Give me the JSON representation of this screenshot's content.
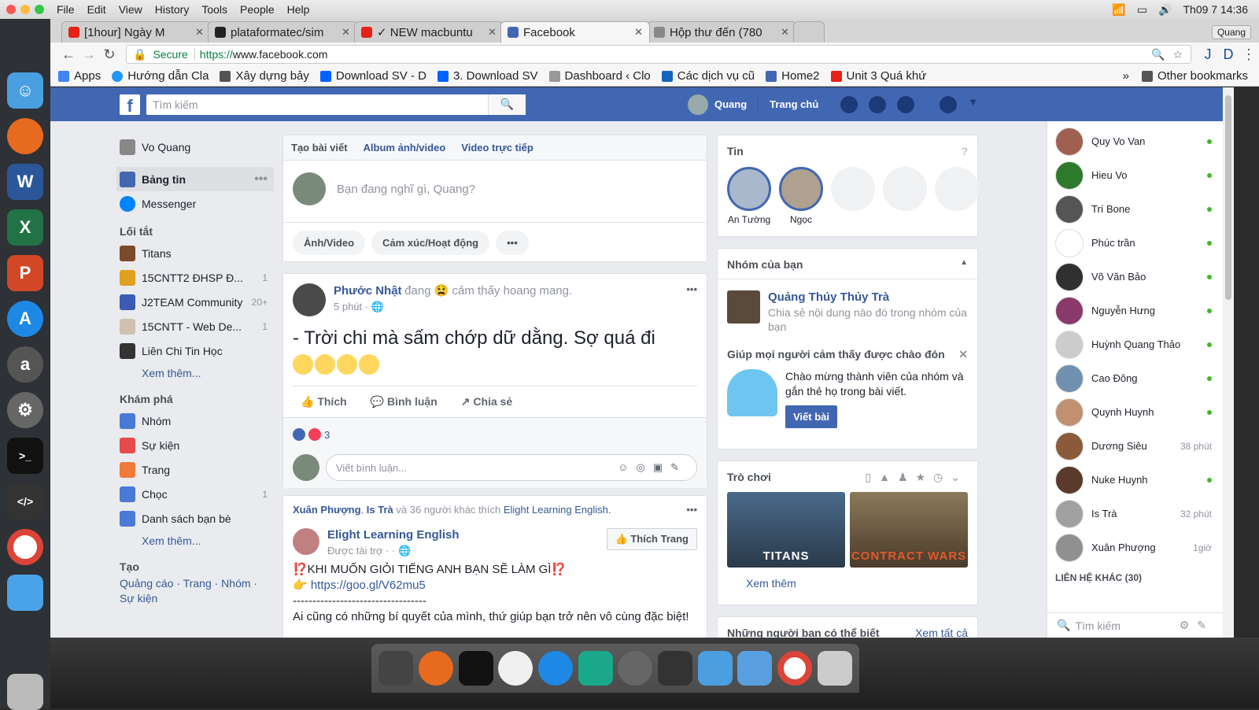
{
  "menubar": {
    "items": [
      "File",
      "Edit",
      "View",
      "History",
      "Tools",
      "People",
      "Help"
    ],
    "clock": "Th09 7 14:36",
    "user": "Quang"
  },
  "tabs": [
    {
      "title": "[1hour] Ngày M",
      "color": "#e62117"
    },
    {
      "title": "plataformatec/sim",
      "color": "#222222"
    },
    {
      "title": "✓ NEW macbuntu",
      "color": "#e62117"
    },
    {
      "title": "Facebook",
      "color": "#4267b2"
    },
    {
      "title": "Hộp thư đến (780",
      "color": "#888888"
    }
  ],
  "address": {
    "secure": "Secure",
    "https": "https://",
    "url": "www.facebook.com"
  },
  "bookmarks": [
    {
      "label": "Apps",
      "color": "#4285f4"
    },
    {
      "label": "Hướng dẫn Cla",
      "color": "#2196f3"
    },
    {
      "label": "Xây dựng bảy",
      "color": "#555555"
    },
    {
      "label": "Download SV - D",
      "color": "#0061ff"
    },
    {
      "label": "3. Download SV",
      "color": "#0061ff"
    },
    {
      "label": "Dashboard ‹ Clo",
      "color": "#999999"
    },
    {
      "label": "Các dịch vụ cũ",
      "color": "#1565c0"
    },
    {
      "label": "Home2",
      "color": "#4267b2"
    },
    {
      "label": "Unit 3 Quá khứ",
      "color": "#e62117"
    }
  ],
  "other_bookmarks": "Other bookmarks",
  "fb": {
    "search_placeholder": "Tìm kiếm",
    "user": "Quang",
    "home": "Trang chủ"
  },
  "left": {
    "profile": "Vo Quang",
    "main": [
      {
        "label": "Bảng tin",
        "color": "#4267b2"
      },
      {
        "label": "Messenger",
        "color": "#0084ff"
      }
    ],
    "shortcuts_title": "Lối tắt",
    "shortcuts": [
      {
        "label": "Titans",
        "count": "",
        "color": "#7a4a2a"
      },
      {
        "label": "15CNTT2 ĐHSP Đ...",
        "count": "1",
        "color": "#e0a020"
      },
      {
        "label": "J2TEAM Community",
        "count": "20+",
        "color": "#3b5bb5"
      },
      {
        "label": "15CNTT - Web De...",
        "count": "1",
        "color": "#d0c0b0"
      },
      {
        "label": "Liên Chi Tin Học",
        "count": "",
        "color": "#333333"
      }
    ],
    "see_more": "Xem thêm...",
    "explore_title": "Khám phá",
    "explore": [
      {
        "label": "Nhóm",
        "count": "",
        "color": "#4a79d6"
      },
      {
        "label": "Sự kiện",
        "count": "",
        "color": "#e64b4b"
      },
      {
        "label": "Trang",
        "count": "",
        "color": "#f07a3a"
      },
      {
        "label": "Chọc",
        "count": "1",
        "color": "#4a79d6"
      },
      {
        "label": "Danh sách bạn bè",
        "count": "",
        "color": "#4a79d6"
      }
    ],
    "create_title": "Tạo",
    "create_links": "Quảng cáo · Trang · Nhóm · Sự kiện"
  },
  "composer": {
    "tabs": [
      "Tạo bài viết",
      "Album ảnh/video",
      "Video trực tiếp"
    ],
    "placeholder": "Bạn đang nghĩ gì, Quang?",
    "actions": [
      "Ảnh/Video",
      "Cảm xúc/Hoạt động"
    ]
  },
  "post1": {
    "author": "Phước Nhật",
    "feeling": "đang 😫 cảm thấy hoang mang.",
    "time": "5 phút · 🌐",
    "text": "- Trời chi mà sấm chớp dữ dằng. Sợ quá đi",
    "like": "Thích",
    "comment": "Bình luận",
    "share": "Chia sẻ",
    "reactions": "3",
    "comment_placeholder": "Viết bình luận..."
  },
  "post2": {
    "liked_by_1": "Xuân Phượng",
    "liked_by_2": "Is Trà",
    "liked_rest": "và 36 người khác thích",
    "liked_page": "Elight Learning English.",
    "page": "Elight Learning English",
    "sponsored": "Được tài trợ · · 🌐",
    "like_page": "Thích Trang",
    "line1": "⁉️KHI MUỐN GIỎI TIẾNG ANH BẠN SẼ LÀM GÌ⁉️",
    "link": "👉 https://goo.gl/V62mu5",
    "divider": "----------------------------------",
    "line3": "Ai cũng có những bí quyết của mình, thứ giúp bạn trở nên vô cùng đặc biệt!"
  },
  "stories": {
    "title": "Tin",
    "items": [
      "An Tường",
      "Ngọc"
    ]
  },
  "groups": {
    "title": "Nhóm của bạn",
    "group": "Quảng Thúy Thủy Trà",
    "group_sub": "Chia sẻ nội dung nào đó trong nhóm của bạn",
    "welcome_title": "Giúp mọi người cảm thấy được chào đón",
    "welcome_text": "Chào mừng thành viên của nhóm và gắn thẻ họ trong bài viết.",
    "welcome_btn": "Viết bài"
  },
  "games": {
    "title": "Trò chơi",
    "items": [
      {
        "label": "TITANS",
        "color": "#3a4f6a"
      },
      {
        "label": "CONTRACT WARS",
        "color": "#6a5a3a"
      }
    ],
    "see_more": "Xem thêm"
  },
  "suggest": {
    "title": "Những người bạn có thể biết",
    "see_all": "Xem tất cả"
  },
  "chat": {
    "contacts": [
      {
        "name": "Quy Vo Van",
        "time": "",
        "color": "#a06050"
      },
      {
        "name": "Hieu Vo",
        "time": "",
        "color": "#2d7a2d"
      },
      {
        "name": "Trí Bone",
        "time": "",
        "color": "#555555"
      },
      {
        "name": "Phúc trần",
        "time": "",
        "color": "#ffffff"
      },
      {
        "name": "Võ Văn Bảo",
        "time": "",
        "color": "#303030"
      },
      {
        "name": "Nguyễn Hưng",
        "time": "",
        "color": "#8a3a6a"
      },
      {
        "name": "Huỳnh Quang Thảo",
        "time": "",
        "color": "#cccccc"
      },
      {
        "name": "Cao Đông",
        "time": "",
        "color": "#7090b0"
      },
      {
        "name": "Quynh Huynh",
        "time": "",
        "color": "#c09070"
      },
      {
        "name": "Dương Siêu",
        "time": "38 phút",
        "color": "#8a5a3a"
      },
      {
        "name": "Nuke Huynh",
        "time": "",
        "color": "#5a3a2a"
      },
      {
        "name": "Is Trà",
        "time": "32 phút",
        "color": "#a0a0a0"
      },
      {
        "name": "Xuân Phượng",
        "time": "1giờ",
        "color": "#909090"
      }
    ],
    "other_contacts": "LIÊN HỆ KHÁC (30)",
    "search_placeholder": "Tìm kiếm"
  }
}
